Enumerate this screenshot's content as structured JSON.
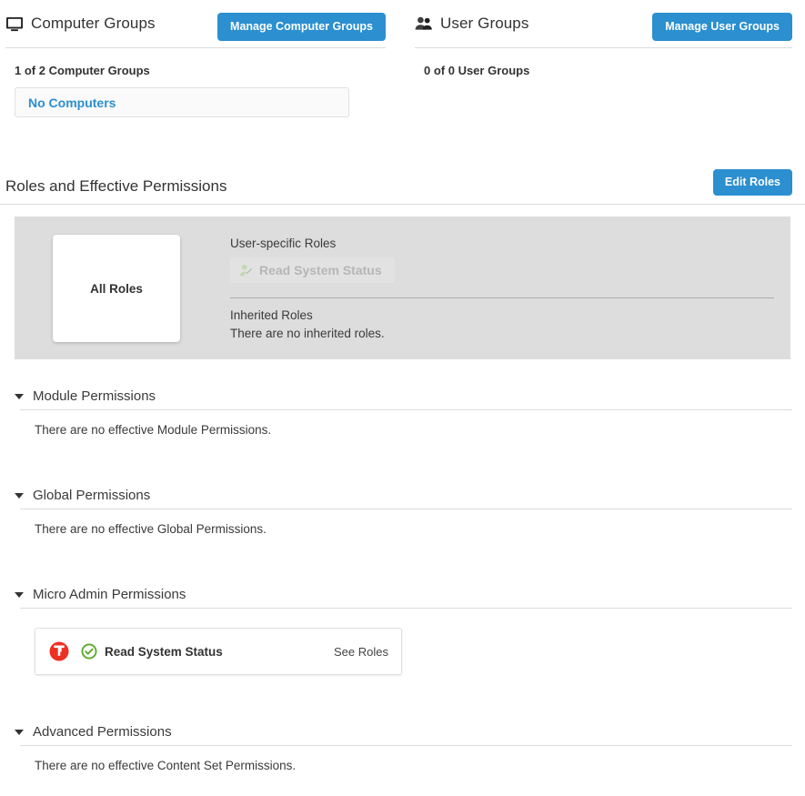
{
  "computer_groups": {
    "icon": "monitor-icon",
    "title": "Computer Groups",
    "manage_button": "Manage Computer Groups",
    "count_label": "1 of 2 Computer Groups",
    "items": [
      {
        "label": "No Computers"
      }
    ]
  },
  "user_groups": {
    "icon": "users-icon",
    "title": "User Groups",
    "manage_button": "Manage User Groups",
    "count_label": "0 of 0 User Groups",
    "items": []
  },
  "roles_section": {
    "title": "Roles and Effective Permissions",
    "edit_button": "Edit Roles",
    "all_roles_card": "All Roles",
    "user_specific_heading": "User-specific Roles",
    "user_specific_roles": [
      {
        "label": "Read System Status",
        "icon": "user-edit-icon"
      }
    ],
    "inherited_heading": "Inherited Roles",
    "inherited_empty": "There are no inherited roles."
  },
  "permission_sections": [
    {
      "id": "module",
      "caret": "caret-down-icon",
      "title": "Module Permissions",
      "empty_text": "There are no effective Module Permissions."
    },
    {
      "id": "global",
      "caret": "caret-down-icon",
      "title": "Global Permissions",
      "empty_text": "There are no effective Global Permissions."
    },
    {
      "id": "micro-admin",
      "caret": "caret-down-icon",
      "title": "Micro Admin Permissions",
      "empty_text": ""
    },
    {
      "id": "advanced",
      "caret": "caret-down-icon",
      "title": "Advanced Permissions",
      "empty_text": "There are no effective Content Set Permissions."
    }
  ],
  "micro_admin_card": {
    "product_logo": "tanium-logo-icon",
    "status_icon": "check-circle-icon",
    "label": "Read System Status",
    "link": "See Roles"
  },
  "colors": {
    "accent_blue": "#2b8fd0",
    "link_blue": "#2b8fd0",
    "panel_gray": "#dddddd",
    "status_green": "#5cab2e",
    "brand_red": "#ed3024",
    "text": "#333333"
  }
}
